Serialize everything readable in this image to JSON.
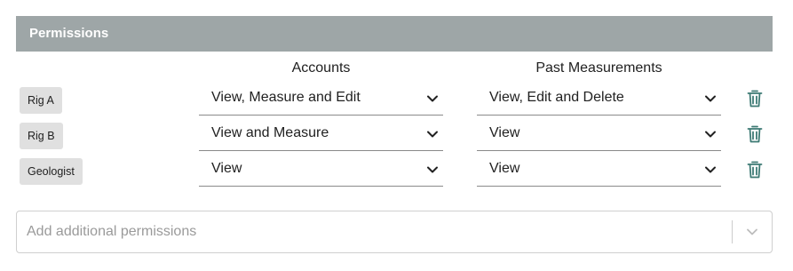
{
  "panel": {
    "title": "Permissions"
  },
  "columns": {
    "accounts": "Accounts",
    "past_measurements": "Past Measurements"
  },
  "rows": [
    {
      "role": "Rig A",
      "accounts": "View, Measure and Edit",
      "past_measurements": "View, Edit and Delete"
    },
    {
      "role": "Rig B",
      "accounts": "View and Measure",
      "past_measurements": "View"
    },
    {
      "role": "Geologist",
      "accounts": "View",
      "past_measurements": "View"
    }
  ],
  "add": {
    "placeholder": "Add additional permissions"
  },
  "icons": {
    "dropdown": "chevron-down-icon",
    "delete": "trash-icon"
  },
  "colors": {
    "header_bg": "#9ea6a7",
    "trash": "#3d7a74",
    "chip_bg": "#e0e0e0"
  }
}
